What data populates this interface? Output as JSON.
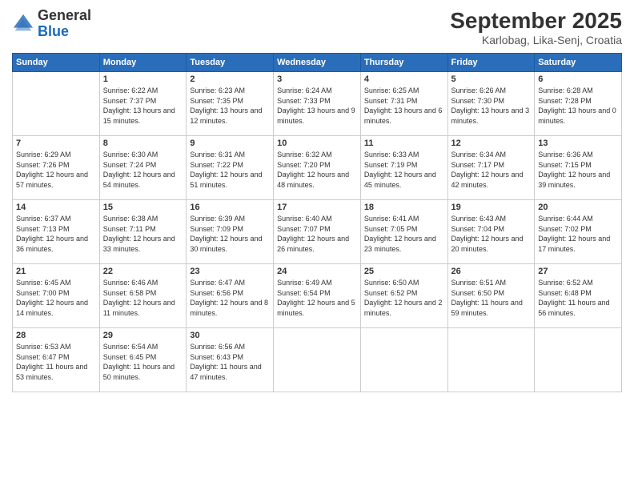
{
  "header": {
    "logo_general": "General",
    "logo_blue": "Blue",
    "title": "September 2025",
    "subtitle": "Karlobag, Lika-Senj, Croatia"
  },
  "days_of_week": [
    "Sunday",
    "Monday",
    "Tuesday",
    "Wednesday",
    "Thursday",
    "Friday",
    "Saturday"
  ],
  "weeks": [
    [
      {
        "day": "",
        "sunrise": "",
        "sunset": "",
        "daylight": ""
      },
      {
        "day": "1",
        "sunrise": "Sunrise: 6:22 AM",
        "sunset": "Sunset: 7:37 PM",
        "daylight": "Daylight: 13 hours and 15 minutes."
      },
      {
        "day": "2",
        "sunrise": "Sunrise: 6:23 AM",
        "sunset": "Sunset: 7:35 PM",
        "daylight": "Daylight: 13 hours and 12 minutes."
      },
      {
        "day": "3",
        "sunrise": "Sunrise: 6:24 AM",
        "sunset": "Sunset: 7:33 PM",
        "daylight": "Daylight: 13 hours and 9 minutes."
      },
      {
        "day": "4",
        "sunrise": "Sunrise: 6:25 AM",
        "sunset": "Sunset: 7:31 PM",
        "daylight": "Daylight: 13 hours and 6 minutes."
      },
      {
        "day": "5",
        "sunrise": "Sunrise: 6:26 AM",
        "sunset": "Sunset: 7:30 PM",
        "daylight": "Daylight: 13 hours and 3 minutes."
      },
      {
        "day": "6",
        "sunrise": "Sunrise: 6:28 AM",
        "sunset": "Sunset: 7:28 PM",
        "daylight": "Daylight: 13 hours and 0 minutes."
      }
    ],
    [
      {
        "day": "7",
        "sunrise": "Sunrise: 6:29 AM",
        "sunset": "Sunset: 7:26 PM",
        "daylight": "Daylight: 12 hours and 57 minutes."
      },
      {
        "day": "8",
        "sunrise": "Sunrise: 6:30 AM",
        "sunset": "Sunset: 7:24 PM",
        "daylight": "Daylight: 12 hours and 54 minutes."
      },
      {
        "day": "9",
        "sunrise": "Sunrise: 6:31 AM",
        "sunset": "Sunset: 7:22 PM",
        "daylight": "Daylight: 12 hours and 51 minutes."
      },
      {
        "day": "10",
        "sunrise": "Sunrise: 6:32 AM",
        "sunset": "Sunset: 7:20 PM",
        "daylight": "Daylight: 12 hours and 48 minutes."
      },
      {
        "day": "11",
        "sunrise": "Sunrise: 6:33 AM",
        "sunset": "Sunset: 7:19 PM",
        "daylight": "Daylight: 12 hours and 45 minutes."
      },
      {
        "day": "12",
        "sunrise": "Sunrise: 6:34 AM",
        "sunset": "Sunset: 7:17 PM",
        "daylight": "Daylight: 12 hours and 42 minutes."
      },
      {
        "day": "13",
        "sunrise": "Sunrise: 6:36 AM",
        "sunset": "Sunset: 7:15 PM",
        "daylight": "Daylight: 12 hours and 39 minutes."
      }
    ],
    [
      {
        "day": "14",
        "sunrise": "Sunrise: 6:37 AM",
        "sunset": "Sunset: 7:13 PM",
        "daylight": "Daylight: 12 hours and 36 minutes."
      },
      {
        "day": "15",
        "sunrise": "Sunrise: 6:38 AM",
        "sunset": "Sunset: 7:11 PM",
        "daylight": "Daylight: 12 hours and 33 minutes."
      },
      {
        "day": "16",
        "sunrise": "Sunrise: 6:39 AM",
        "sunset": "Sunset: 7:09 PM",
        "daylight": "Daylight: 12 hours and 30 minutes."
      },
      {
        "day": "17",
        "sunrise": "Sunrise: 6:40 AM",
        "sunset": "Sunset: 7:07 PM",
        "daylight": "Daylight: 12 hours and 26 minutes."
      },
      {
        "day": "18",
        "sunrise": "Sunrise: 6:41 AM",
        "sunset": "Sunset: 7:05 PM",
        "daylight": "Daylight: 12 hours and 23 minutes."
      },
      {
        "day": "19",
        "sunrise": "Sunrise: 6:43 AM",
        "sunset": "Sunset: 7:04 PM",
        "daylight": "Daylight: 12 hours and 20 minutes."
      },
      {
        "day": "20",
        "sunrise": "Sunrise: 6:44 AM",
        "sunset": "Sunset: 7:02 PM",
        "daylight": "Daylight: 12 hours and 17 minutes."
      }
    ],
    [
      {
        "day": "21",
        "sunrise": "Sunrise: 6:45 AM",
        "sunset": "Sunset: 7:00 PM",
        "daylight": "Daylight: 12 hours and 14 minutes."
      },
      {
        "day": "22",
        "sunrise": "Sunrise: 6:46 AM",
        "sunset": "Sunset: 6:58 PM",
        "daylight": "Daylight: 12 hours and 11 minutes."
      },
      {
        "day": "23",
        "sunrise": "Sunrise: 6:47 AM",
        "sunset": "Sunset: 6:56 PM",
        "daylight": "Daylight: 12 hours and 8 minutes."
      },
      {
        "day": "24",
        "sunrise": "Sunrise: 6:49 AM",
        "sunset": "Sunset: 6:54 PM",
        "daylight": "Daylight: 12 hours and 5 minutes."
      },
      {
        "day": "25",
        "sunrise": "Sunrise: 6:50 AM",
        "sunset": "Sunset: 6:52 PM",
        "daylight": "Daylight: 12 hours and 2 minutes."
      },
      {
        "day": "26",
        "sunrise": "Sunrise: 6:51 AM",
        "sunset": "Sunset: 6:50 PM",
        "daylight": "Daylight: 11 hours and 59 minutes."
      },
      {
        "day": "27",
        "sunrise": "Sunrise: 6:52 AM",
        "sunset": "Sunset: 6:48 PM",
        "daylight": "Daylight: 11 hours and 56 minutes."
      }
    ],
    [
      {
        "day": "28",
        "sunrise": "Sunrise: 6:53 AM",
        "sunset": "Sunset: 6:47 PM",
        "daylight": "Daylight: 11 hours and 53 minutes."
      },
      {
        "day": "29",
        "sunrise": "Sunrise: 6:54 AM",
        "sunset": "Sunset: 6:45 PM",
        "daylight": "Daylight: 11 hours and 50 minutes."
      },
      {
        "day": "30",
        "sunrise": "Sunrise: 6:56 AM",
        "sunset": "Sunset: 6:43 PM",
        "daylight": "Daylight: 11 hours and 47 minutes."
      },
      {
        "day": "",
        "sunrise": "",
        "sunset": "",
        "daylight": ""
      },
      {
        "day": "",
        "sunrise": "",
        "sunset": "",
        "daylight": ""
      },
      {
        "day": "",
        "sunrise": "",
        "sunset": "",
        "daylight": ""
      },
      {
        "day": "",
        "sunrise": "",
        "sunset": "",
        "daylight": ""
      }
    ]
  ]
}
